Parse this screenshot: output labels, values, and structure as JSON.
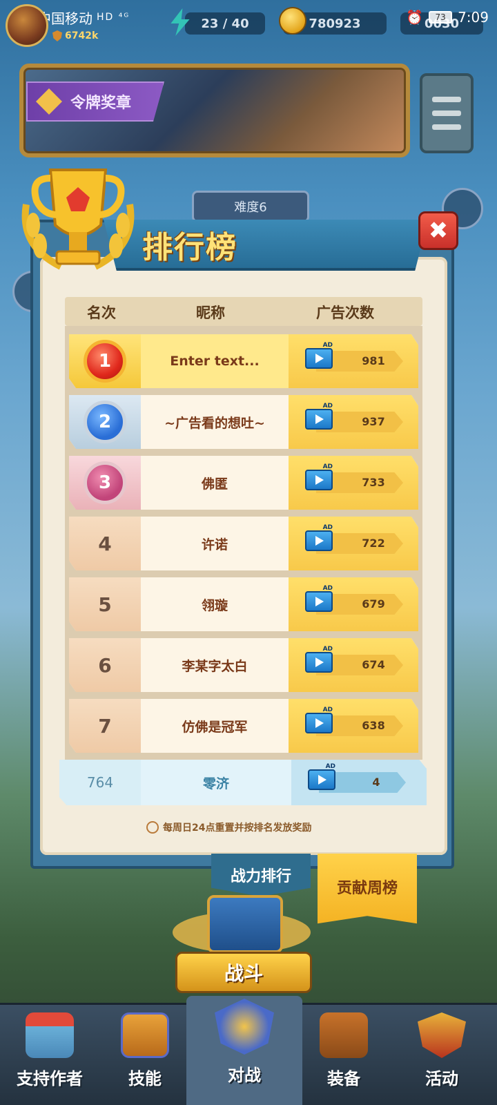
{
  "status_bar": {
    "carrier": "中国移动",
    "network_icons": "HD ⁴ᴳ",
    "battery": "73",
    "time": "7:09"
  },
  "hud": {
    "combat_power": "6742k",
    "energy": "23 / 40",
    "gold": "780923",
    "gems": "0030"
  },
  "banner": {
    "medal_tab_label": "令牌奖章"
  },
  "difficulty_label": "难度6",
  "ranking": {
    "title": "排行榜",
    "close_label": "✖",
    "headers": {
      "rank": "名次",
      "name": "昵称",
      "ads": "广告次数"
    },
    "ad_badge": "AD",
    "rows": [
      {
        "rank": "1",
        "name": "Enter text...",
        "ads": "981"
      },
      {
        "rank": "2",
        "name": "~广告看的想吐~",
        "ads": "937"
      },
      {
        "rank": "3",
        "name": "佛匿",
        "ads": "733"
      },
      {
        "rank": "4",
        "name": "许诺",
        "ads": "722"
      },
      {
        "rank": "5",
        "name": "翎璇",
        "ads": "679"
      },
      {
        "rank": "6",
        "name": "李某字太白",
        "ads": "674"
      },
      {
        "rank": "7",
        "name": "仿佛是冠军",
        "ads": "638"
      }
    ],
    "self_row": {
      "rank": "764",
      "name": "零济",
      "ads": "4"
    },
    "footer_note": "每周日24点重置并按排名发放奖励"
  },
  "tabs": {
    "power_rank": "战力排行",
    "weekly_contribution": "贡献周榜"
  },
  "fight_button": "战斗",
  "bottom_nav": {
    "items": [
      {
        "label": "支持作者"
      },
      {
        "label": "技能"
      },
      {
        "label": "对战"
      },
      {
        "label": "装备"
      },
      {
        "label": "活动"
      }
    ]
  },
  "colors": {
    "panel_blue": "#3f7aa0",
    "gold_accent": "#ffdf6a",
    "close_red": "#e0402e",
    "title_yellow": "#ffe278"
  }
}
